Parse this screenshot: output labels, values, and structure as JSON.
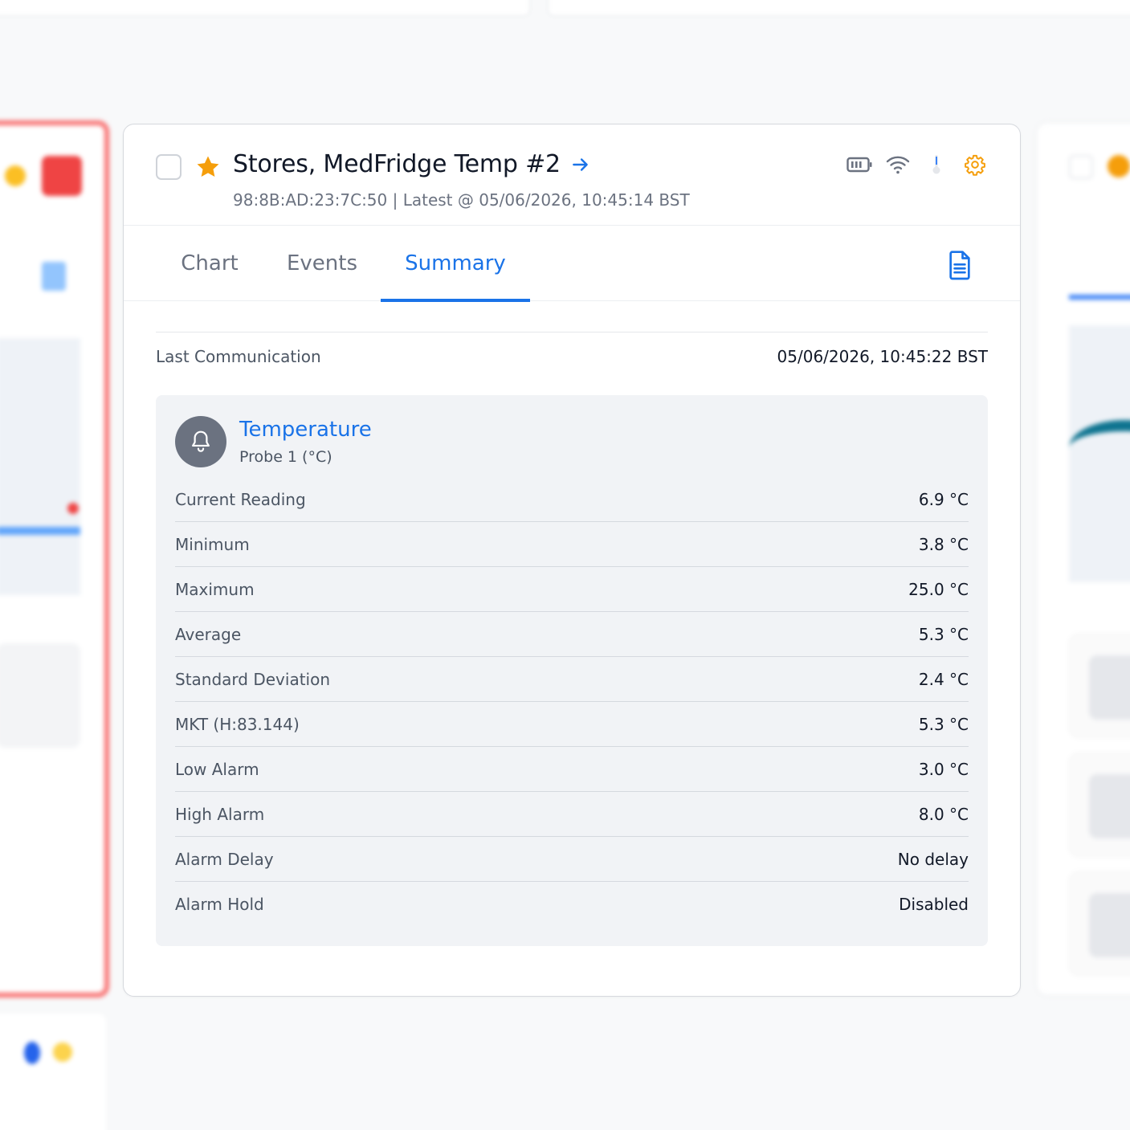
{
  "device": {
    "title": "Stores, MedFridge Temp #2",
    "subtitle": "98:8B:AD:23:7C:50 | Latest @ 05/06/2026, 10:45:14 BST",
    "starred": true
  },
  "status_icons": [
    "battery-icon",
    "wifi-icon",
    "thermometer-icon",
    "gear-icon"
  ],
  "tabs": [
    {
      "label": "Chart",
      "active": false
    },
    {
      "label": "Events",
      "active": false
    },
    {
      "label": "Summary",
      "active": true
    }
  ],
  "summary": {
    "last_communication_label": "Last Communication",
    "last_communication_value": "05/06/2026, 10:45:22 BST",
    "sensor": {
      "name": "Temperature",
      "probe": "Probe 1 (°C)",
      "rows": [
        {
          "label": "Current Reading",
          "value": "6.9 °C"
        },
        {
          "label": "Minimum",
          "value": "3.8 °C"
        },
        {
          "label": "Maximum",
          "value": "25.0 °C"
        },
        {
          "label": "Average",
          "value": "5.3 °C"
        },
        {
          "label": "Standard Deviation",
          "value": "2.4 °C"
        },
        {
          "label": "MKT (H:83.144)",
          "value": "5.3 °C"
        },
        {
          "label": "Low Alarm",
          "value": "3.0 °C"
        },
        {
          "label": "High Alarm",
          "value": "8.0 °C"
        },
        {
          "label": "Alarm Delay",
          "value": "No delay"
        },
        {
          "label": "Alarm Hold",
          "value": "Disabled"
        }
      ]
    }
  },
  "colors": {
    "accent": "#1a73e8",
    "star": "#f59e0b",
    "gear": "#f59e0b",
    "alarm_border": "#f87171"
  }
}
